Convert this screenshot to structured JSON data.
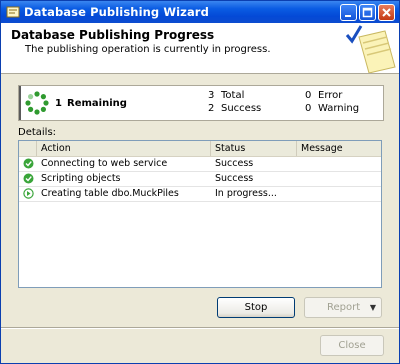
{
  "window": {
    "title": "Database Publishing Wizard"
  },
  "header": {
    "title": "Database Publishing Progress",
    "subtitle": "The publishing operation is currently in progress."
  },
  "progress": {
    "remaining_count": "1",
    "remaining_label": "Remaining",
    "total_count": "3",
    "total_label": "Total",
    "success_count": "2",
    "success_label": "Success",
    "error_count": "0",
    "error_label": "Error",
    "warning_count": "0",
    "warning_label": "Warning"
  },
  "details": {
    "label": "Details:",
    "columns": [
      "Action",
      "Status",
      "Message"
    ],
    "rows": [
      {
        "icon": "success-check-icon",
        "action": "Connecting to web service",
        "status": "Success",
        "message": ""
      },
      {
        "icon": "success-check-icon",
        "action": "Scripting objects",
        "status": "Success",
        "message": ""
      },
      {
        "icon": "in-progress-arrow-icon",
        "action": "Creating table dbo.MuckPiles",
        "status": "In progress...",
        "message": ""
      }
    ]
  },
  "buttons": {
    "stop": "Stop",
    "report": "Report",
    "close": "Close"
  },
  "colors": {
    "titlebar": "#0449d6",
    "success": "#3aa53a",
    "window_bg": "#ece9d8"
  }
}
